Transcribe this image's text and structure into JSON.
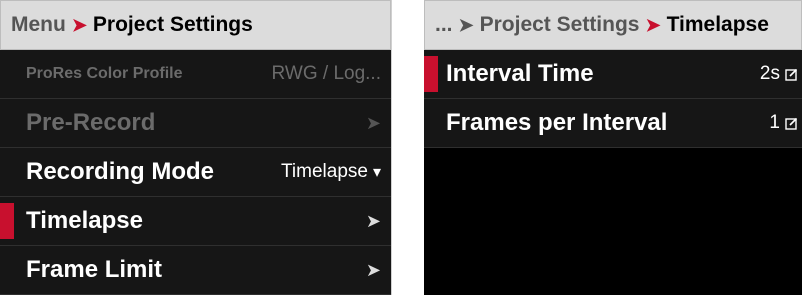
{
  "left": {
    "breadcrumb": {
      "root": "Menu",
      "separator": "➤",
      "current": "Project Settings"
    },
    "rows": [
      {
        "label": "ProRes Color Profile",
        "value": "RWG / Log...",
        "disabled": true
      },
      {
        "label": "Pre-Record",
        "disabled": true,
        "chevron": "➤"
      },
      {
        "label": "Recording Mode",
        "value": "Timelapse",
        "dropdown": "▾"
      },
      {
        "label": "Timelapse",
        "selected": true,
        "chevron": "➤"
      },
      {
        "label": "Frame Limit",
        "chevron": "➤"
      }
    ]
  },
  "right": {
    "breadcrumb": {
      "root": "...",
      "separator1": "➤",
      "middle": "Project Settings",
      "separator2": "➤",
      "current": "Timelapse"
    },
    "rows": [
      {
        "label": "Interval Time",
        "value": "2s",
        "selected": true
      },
      {
        "label": "Frames per Interval",
        "value": "1"
      }
    ]
  },
  "colors": {
    "accent": "#c8102e",
    "panel_bg": "#000000",
    "row_bg": "#161616",
    "breadcrumb_bg": "#dcdcdc"
  },
  "icons": {
    "edit": "edit-icon",
    "chevron": "chevron-right-icon",
    "dropdown": "chevron-down-icon"
  }
}
